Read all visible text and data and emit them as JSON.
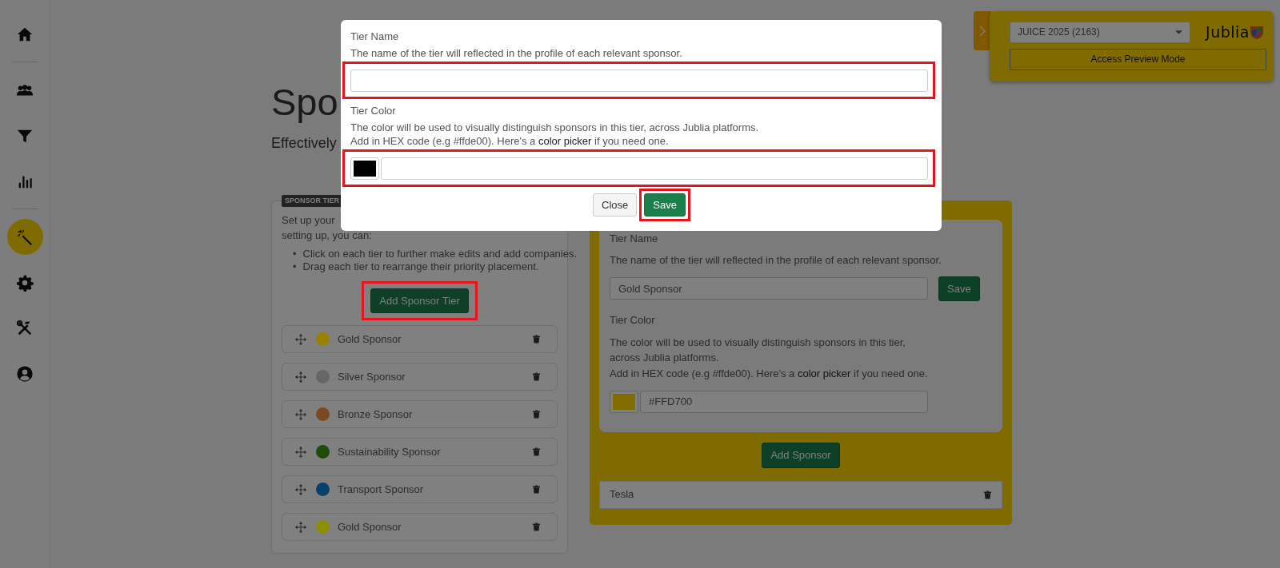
{
  "sidebar": {
    "items": [
      {
        "selected": false
      },
      {
        "selected": false
      },
      {
        "selected": false
      },
      {
        "selected": false
      },
      {
        "selected": true
      },
      {
        "selected": false
      },
      {
        "selected": false
      },
      {
        "selected": false
      }
    ]
  },
  "header": {
    "title": "Spo",
    "subtitle": "Effectively"
  },
  "sponsor_tiers": {
    "badge": "SPONSOR TIER",
    "intro": [
      "Set up your",
      "setting up, you can:"
    ],
    "bullets": [
      {
        "marker": "•",
        "text": "Click on each tier to further make edits and add companies."
      },
      {
        "marker": "•",
        "text": "Drag each tier to rearrange their priority placement."
      }
    ],
    "add_button": {
      "label": "Add Sponsor Tier",
      "highlighted": true
    },
    "tiers": [
      {
        "name": "Gold Sponsor",
        "color": "#9a8000"
      },
      {
        "name": "Silver Sponsor",
        "color": "#666666"
      },
      {
        "name": "Bronze Sponsor",
        "color": "#7a4a1e"
      },
      {
        "name": "Sustainability Sponsor",
        "color": "#1f4a08"
      },
      {
        "name": "Transport Sponsor",
        "color": "#0a4068"
      },
      {
        "name": "Gold Sponsor",
        "color": "#8a9000"
      }
    ]
  },
  "tier_settings": {
    "name_label": "Tier Name",
    "name_help": "The name of the tier will reflected in the profile of each relevant sponsor.",
    "name_value": "Gold Sponsor",
    "save_button": "Save",
    "color_label": "Tier Color",
    "color_help": "The color will be used to visually distinguish sponsors in this tier, across Jublia platforms.",
    "hex_help": {
      "before": "Add in HEX code (e.g #ffde00). Here's a",
      "link": "color picker",
      "after": "if you need one."
    },
    "hex_value": "#FFD700",
    "add_sponsor_button": "Add Sponsor",
    "sponsors": [
      {
        "name": "Tesla"
      }
    ]
  },
  "top_panel": {
    "event_select": "JUICE 2025 (2163)",
    "logo": "Jublia",
    "preview_button": "Access Preview Mode"
  },
  "modal": {
    "name_label": "Tier Name",
    "name_help": "The name of the tier will reflected in the profile of each relevant sponsor.",
    "name_field": {
      "highlighted": true
    },
    "color_label": "Tier Color",
    "color_help": "The color will be used to visually distinguish sponsors in this tier, across Jublia platforms.",
    "hex_help": {
      "before": "Add in HEX code (e.g #ffde00). Here's a",
      "link": "color picker",
      "after": "if you need one."
    },
    "color_field": {
      "highlighted": true
    },
    "buttons": [
      {
        "label": "Close",
        "kind": "secondary",
        "highlighted": false
      },
      {
        "label": "Save",
        "kind": "primary",
        "highlighted": true
      }
    ]
  }
}
